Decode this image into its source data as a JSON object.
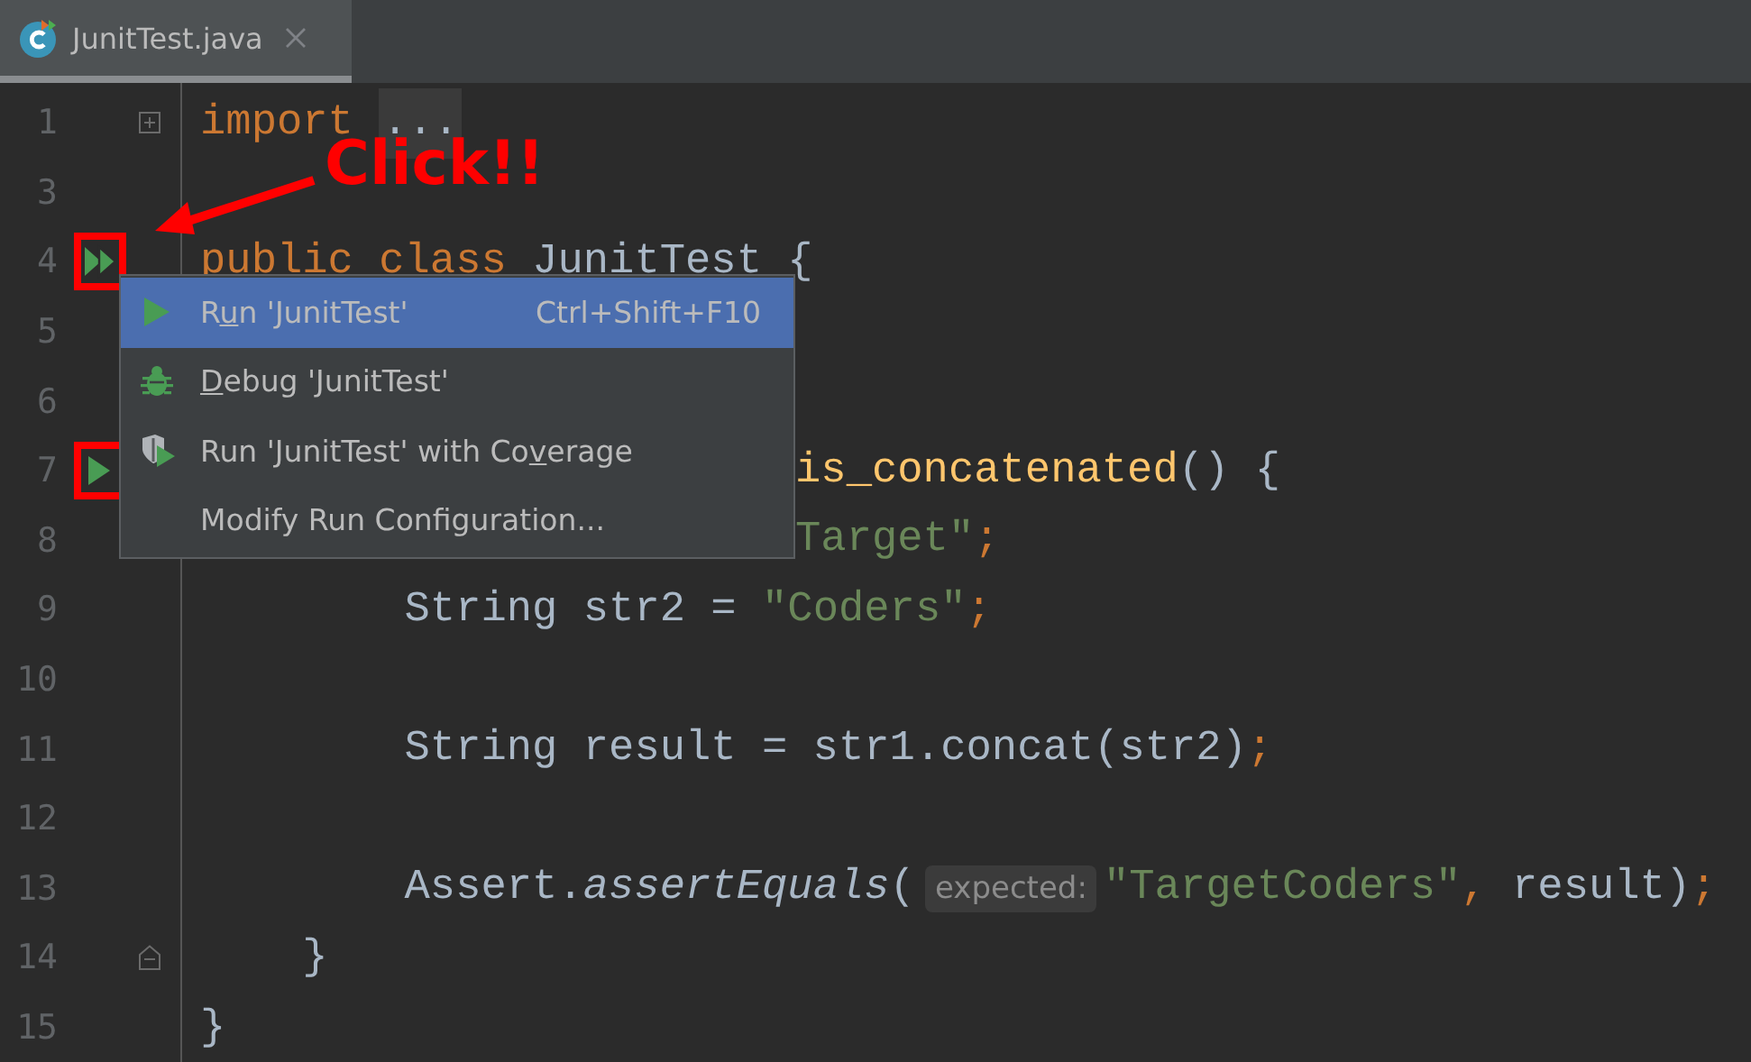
{
  "tab": {
    "title": "JunitTest.java",
    "selected": true
  },
  "lines": [
    {
      "number": "1",
      "folded": true,
      "tokens": [
        {
          "kind": "keyword",
          "text": "import"
        },
        {
          "kind": "folded",
          "text": "..."
        }
      ]
    },
    {
      "number": "3"
    },
    {
      "number": "4",
      "kind": "run_all",
      "highlighted": true,
      "tokens": [
        {
          "kind": "keyword",
          "text": "public class "
        },
        {
          "kind": "plain",
          "text": "JunitTest {"
        }
      ]
    },
    {
      "number": "5"
    },
    {
      "number": "6"
    },
    {
      "number": "7",
      "kind": "run",
      "highlighted": true,
      "covered": true,
      "tokens": [
        {
          "kind": "method",
          "text": "is_concatenated"
        },
        {
          "kind": "plain",
          "text": "() {"
        }
      ]
    },
    {
      "number": "8",
      "covered": true,
      "tokens": [
        {
          "kind": "string",
          "text": "Target\""
        },
        {
          "kind": "punct",
          "text": ";"
        }
      ]
    },
    {
      "number": "9",
      "tokens": [
        {
          "kind": "plain",
          "text": "        String str2 = "
        },
        {
          "kind": "string",
          "text": "\"Coders\""
        },
        {
          "kind": "punct",
          "text": ";"
        }
      ]
    },
    {
      "number": "10"
    },
    {
      "number": "11",
      "tokens": [
        {
          "kind": "plain",
          "text": "        String result = str1.concat(str2)"
        },
        {
          "kind": "punct",
          "text": ";"
        }
      ]
    },
    {
      "number": "12"
    },
    {
      "number": "13",
      "tokens": [
        {
          "kind": "plain",
          "text": "        Assert."
        },
        {
          "kind": "italic",
          "text": "assertEquals"
        },
        {
          "kind": "plain",
          "text": "("
        },
        {
          "kind": "hint",
          "text": "expected:"
        },
        {
          "kind": "string",
          "text": "\"TargetCoders\""
        },
        {
          "kind": "punct",
          "text": ", "
        },
        {
          "kind": "plain",
          "text": "result)"
        },
        {
          "kind": "punct",
          "text": ";"
        }
      ]
    },
    {
      "number": "14",
      "block_end": true,
      "tokens": [
        {
          "kind": "plain",
          "text": "    }"
        }
      ]
    },
    {
      "number": "15",
      "tokens": [
        {
          "kind": "plain",
          "text": "}"
        }
      ]
    }
  ],
  "menu": [
    {
      "kind": "run",
      "label_parts": [
        {
          "text": "R"
        },
        {
          "text": "u",
          "underlined": true
        },
        {
          "text": "n 'JunitTest'"
        }
      ],
      "shortcut": "Ctrl+Shift+F10",
      "selected": true
    },
    {
      "kind": "debug",
      "label_parts": [
        {
          "text": "D",
          "underlined": true
        },
        {
          "text": "ebug 'JunitTest'"
        }
      ],
      "selected": false
    },
    {
      "kind": "coverage",
      "label_parts": [
        {
          "text": "Run 'JunitTest' with Co"
        },
        {
          "text": "v",
          "underlined": true
        },
        {
          "text": "erage"
        }
      ],
      "selected": false
    },
    {
      "kind": "plain",
      "label_parts": [
        {
          "text": "Modify Run Configuration..."
        }
      ],
      "selected": false
    }
  ],
  "annotation": {
    "text": "Click!!"
  }
}
